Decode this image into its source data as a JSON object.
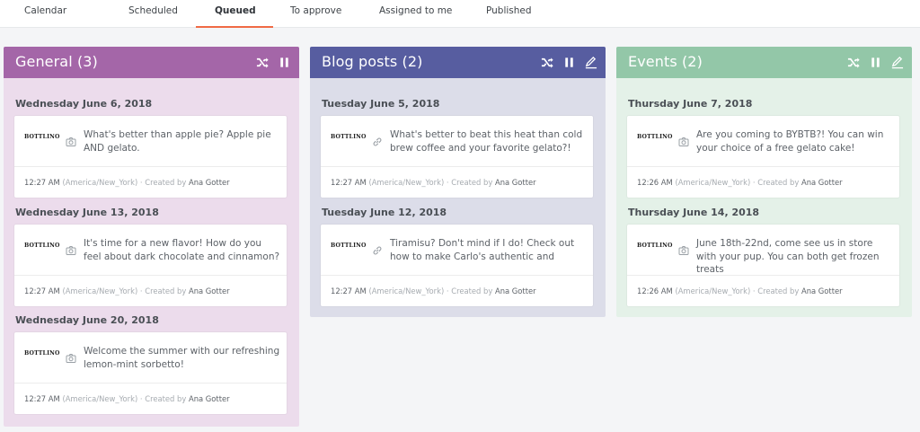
{
  "nav": {
    "tabs": [
      {
        "label": "Calendar"
      },
      {
        "label": "Scheduled"
      },
      {
        "label": "Queued",
        "active": true
      },
      {
        "label": "To approve"
      },
      {
        "label": "Assigned to me"
      },
      {
        "label": "Published"
      }
    ]
  },
  "colors": {
    "accent": "#f06a45",
    "general_header": "#a466a8",
    "general_bg": "#ecdcec",
    "blog_header": "#575da0",
    "blog_bg": "#dcdde9",
    "events_header": "#93c7a8",
    "events_bg": "#e4f1e8"
  },
  "columns": [
    {
      "title": "General (3)",
      "actions": [
        "shuffle-icon",
        "pause-icon"
      ],
      "groups": [
        {
          "date": "Wednesday June 6, 2018",
          "post": {
            "logo": "BOTTLINO",
            "media": "camera-icon",
            "text": "What's better than apple pie? Apple pie AND gelato.",
            "time": "12:27 AM",
            "timezone": "(America/New_York)",
            "created_by": "· Created by",
            "author": "Ana Gotter"
          }
        },
        {
          "date": "Wednesday June 13, 2018",
          "post": {
            "logo": "BOTTLINO",
            "media": "camera-icon",
            "text": "It's time for a new flavor! How do you feel about dark chocolate and cinnamon?",
            "time": "12:27 AM",
            "timezone": "(America/New_York)",
            "created_by": "· Created by",
            "author": "Ana Gotter"
          }
        },
        {
          "date": "Wednesday June 20, 2018",
          "post": {
            "logo": "BOTTLINO",
            "media": "camera-icon",
            "text": "Welcome the summer with our refreshing lemon-mint sorbetto!",
            "time": "12:27 AM",
            "timezone": "(America/New_York)",
            "created_by": "· Created by",
            "author": "Ana Gotter"
          }
        }
      ]
    },
    {
      "title": "Blog posts (2)",
      "actions": [
        "shuffle-icon",
        "pause-icon",
        "edit-icon"
      ],
      "groups": [
        {
          "date": "Tuesday June 5, 2018",
          "post": {
            "logo": "BOTTLINO",
            "media": "link-icon",
            "text": "What's better to beat this heat than cold brew coffee and your favorite gelato?!",
            "time": "12:27 AM",
            "timezone": "(America/New_York)",
            "created_by": "· Created by",
            "author": "Ana Gotter"
          }
        },
        {
          "date": "Tuesday June 12, 2018",
          "post": {
            "logo": "BOTTLINO",
            "media": "link-icon",
            "text": "Tiramisu? Don't mind if I do! Check out how to make Carlo's authentic and",
            "time": "12:27 AM",
            "timezone": "(America/New_York)",
            "created_by": "· Created by",
            "author": "Ana Gotter"
          }
        }
      ]
    },
    {
      "title": "Events (2)",
      "actions": [
        "shuffle-icon",
        "pause-icon",
        "edit-icon"
      ],
      "groups": [
        {
          "date": "Thursday June 7, 2018",
          "post": {
            "logo": "BOTTLINO",
            "media": "camera-icon",
            "text": "Are you coming to BYBTB?! You can win your choice of a free gelato cake!",
            "time": "12:26 AM",
            "timezone": "(America/New_York)",
            "created_by": "· Created by",
            "author": "Ana Gotter"
          }
        },
        {
          "date": "Thursday June 14, 2018",
          "post": {
            "logo": "BOTTLINO",
            "media": "camera-icon",
            "text": "June 18th-22nd, come see us in store with your pup. You can both get frozen treats",
            "time": "12:26 AM",
            "timezone": "(America/New_York)",
            "created_by": "· Created by",
            "author": "Ana Gotter"
          }
        }
      ]
    }
  ]
}
